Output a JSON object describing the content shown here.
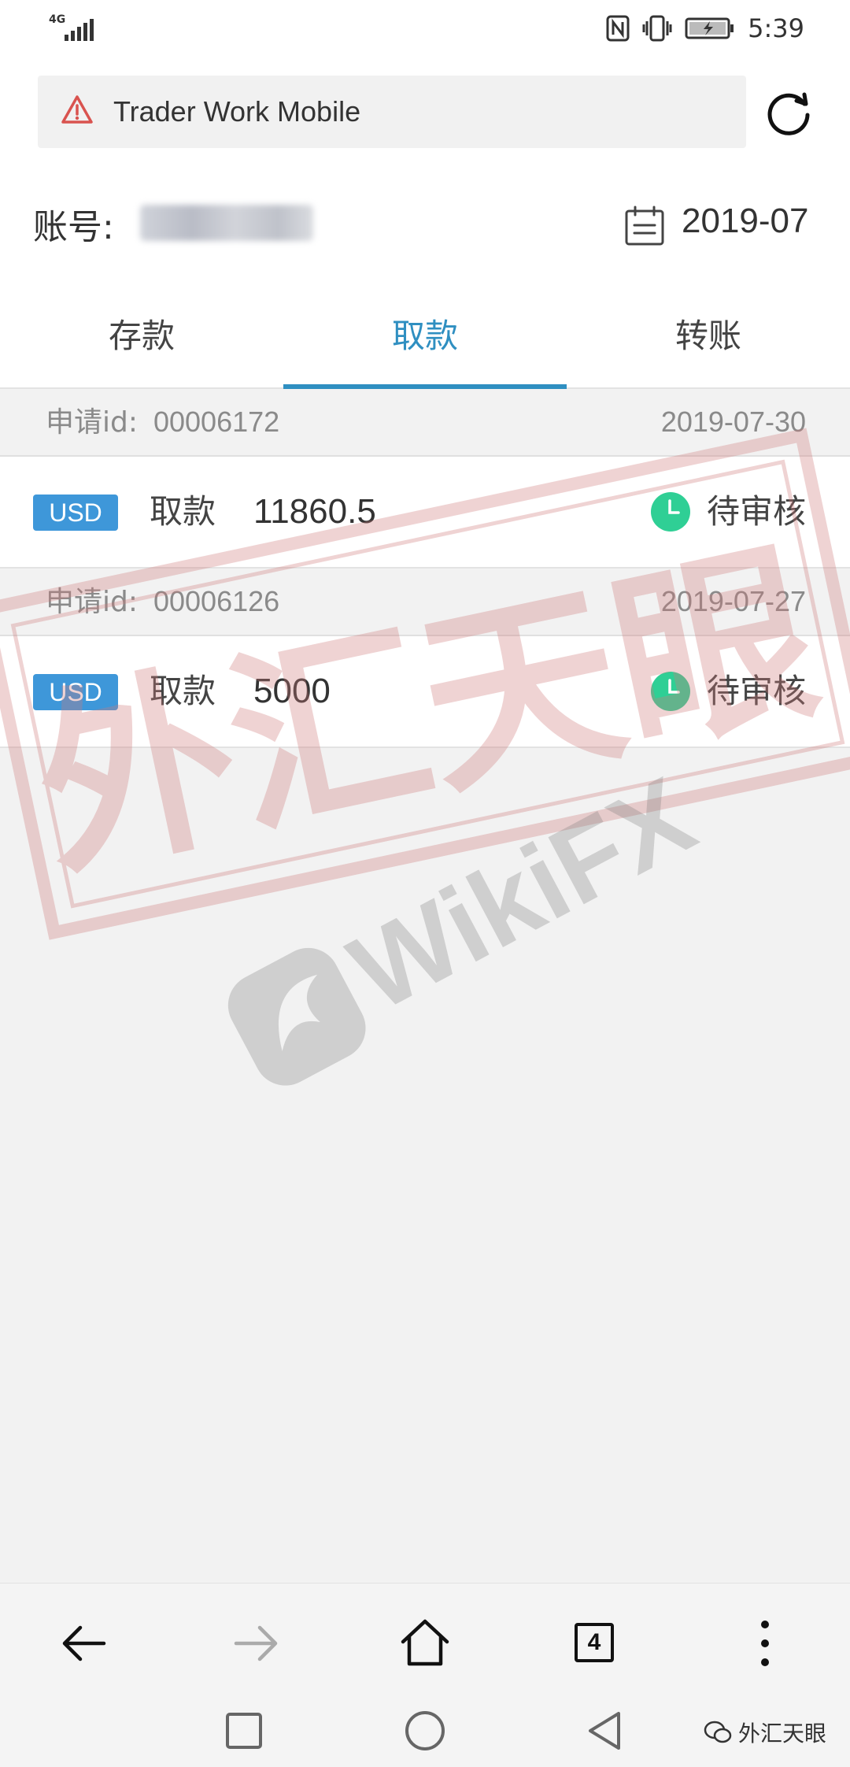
{
  "status_bar": {
    "network": "4G",
    "time": "5:39",
    "icons": [
      "signal-icon",
      "nfc-icon",
      "vibrate-icon",
      "battery-charging-icon"
    ]
  },
  "url_bar": {
    "title": "Trader Work Mobile",
    "icons": [
      "warning-icon",
      "reload-icon"
    ]
  },
  "account": {
    "label": "账号:",
    "value_obscured": true,
    "month": "2019-07"
  },
  "tabs": [
    {
      "label": "存款",
      "active": false
    },
    {
      "label": "取款",
      "active": true
    },
    {
      "label": "转账",
      "active": false
    }
  ],
  "requests": [
    {
      "id_label": "申请id:",
      "id": "00006172",
      "date": "2019-07-30",
      "currency": "USD",
      "type": "取款",
      "amount": "11860.5",
      "status": "待审核"
    },
    {
      "id_label": "申请id:",
      "id": "00006126",
      "date": "2019-07-27",
      "currency": "USD",
      "type": "取款",
      "amount": "5000",
      "status": "待审核"
    }
  ],
  "watermark": {
    "stamp_text": "外汇天眼",
    "brand": "WikiFX"
  },
  "browser_toolbar": {
    "tab_count": "4",
    "icons": [
      "back-arrow-icon",
      "forward-arrow-icon",
      "home-icon",
      "tabs-icon",
      "more-vertical-icon"
    ]
  },
  "system_nav": {
    "icons": [
      "recent-apps-icon",
      "home-circle-icon",
      "back-triangle-icon"
    ],
    "credit": "外汇天眼"
  },
  "colors": {
    "accent": "#2f8fc1",
    "badge": "#3e97d9",
    "pending": "#2fcf95",
    "warning": "#d9534f",
    "stamp": "#d07a7a"
  }
}
